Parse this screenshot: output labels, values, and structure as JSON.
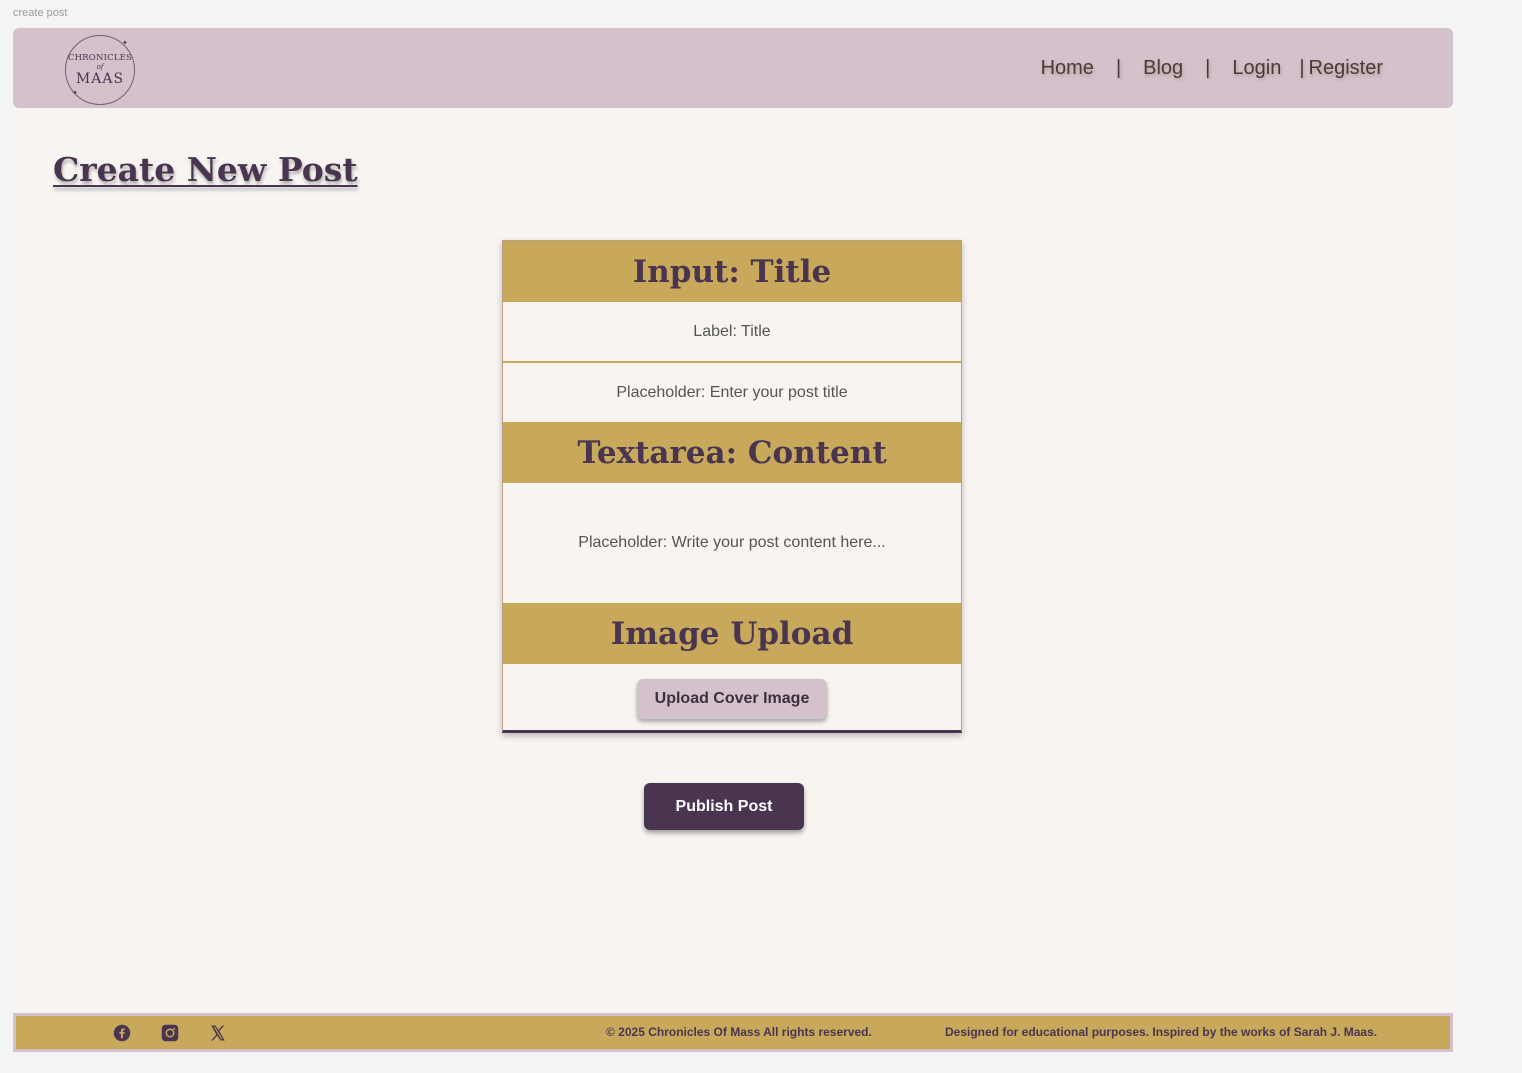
{
  "frame": {
    "label": "create post"
  },
  "nav": {
    "logo": {
      "line1": "CHRONICLES",
      "line2": "of",
      "line3": "MAAS"
    },
    "links": [
      "Home",
      "Blog",
      "Login",
      "Register"
    ],
    "separator": "|"
  },
  "page": {
    "title": "Create New Post"
  },
  "form": {
    "title_section": {
      "heading": "Input: Title",
      "label": "Label: Title",
      "placeholder": "Placeholder: Enter your post title"
    },
    "content_section": {
      "heading": "Textarea: Content",
      "placeholder": "Placeholder: Write your post content here..."
    },
    "image_section": {
      "heading": "Image Upload",
      "button_label": "Upload Cover Image"
    }
  },
  "publish_label": "Publish Post",
  "footer": {
    "copyright": "© 2025 Chronicles Of Mass All rights reserved.",
    "note": "Designed for educational purposes. Inspired by the works of Sarah J. Maas.",
    "social_icons": [
      "facebook-icon",
      "instagram-icon",
      "x-icon"
    ]
  },
  "colors": {
    "nav_bg": "#d3c1cc",
    "gold": "#c8a85a",
    "plum": "#4a3550",
    "page_bg": "#f7f4f1"
  }
}
